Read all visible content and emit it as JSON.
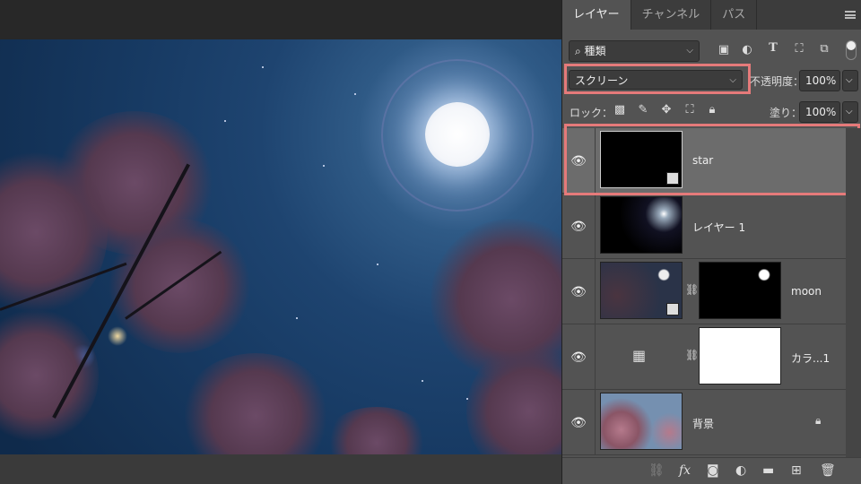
{
  "tabs": [
    "レイヤー",
    "チャンネル",
    "パス"
  ],
  "filter": {
    "label": "種類"
  },
  "blend_mode": "スクリーン",
  "opacity": {
    "label": "不透明度：",
    "value": "100%"
  },
  "lock": {
    "label": "ロック："
  },
  "fill": {
    "label": "塗り：",
    "value": "100%"
  },
  "layers": [
    {
      "name": "star",
      "selected": true
    },
    {
      "name": "レイヤー 1"
    },
    {
      "name": "moon"
    },
    {
      "name": "カラ...1"
    },
    {
      "name": "背景",
      "locked": true
    }
  ],
  "colors": {
    "highlight": "#e57a7a",
    "panel": "#535353"
  }
}
